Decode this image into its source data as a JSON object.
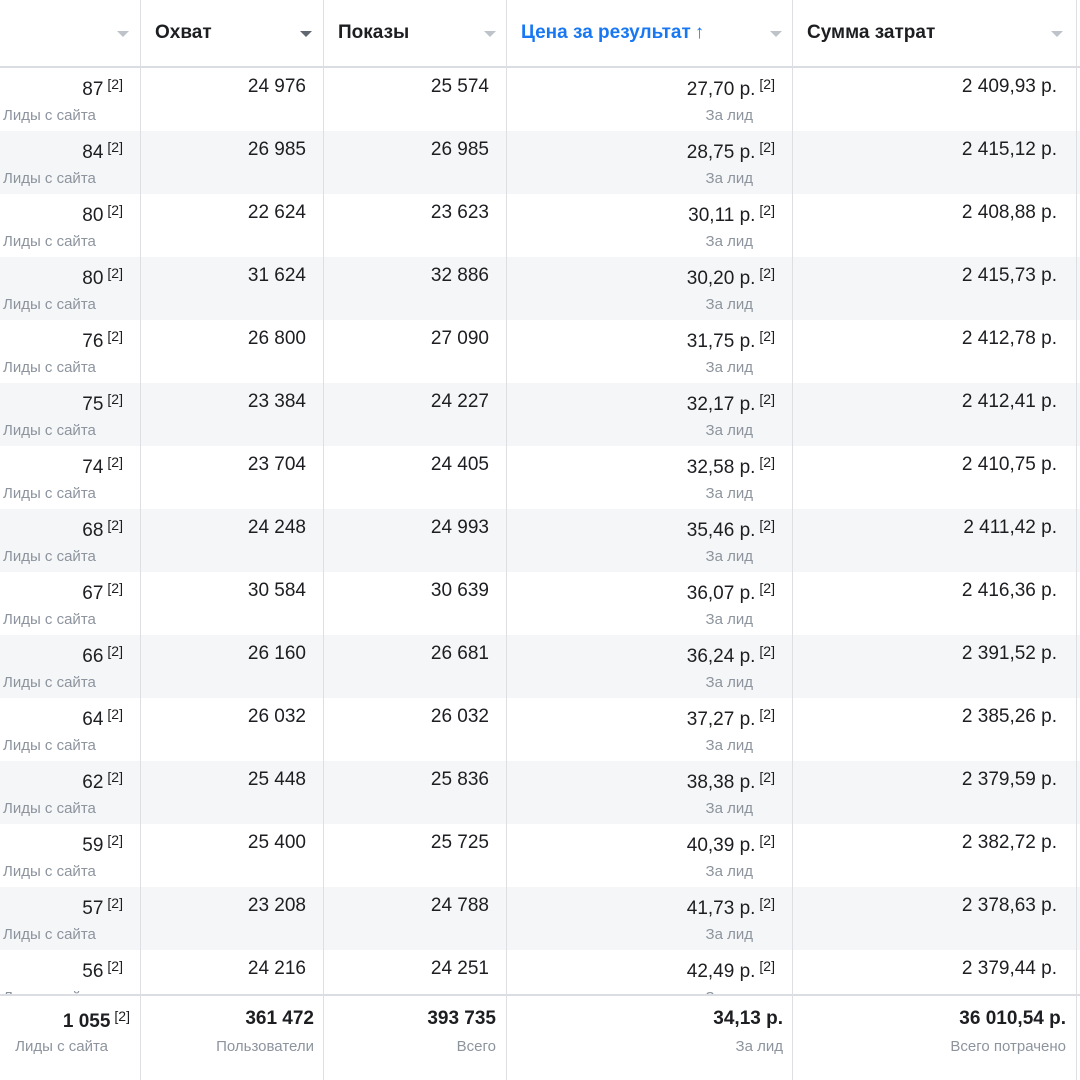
{
  "columns": {
    "results": {
      "label": ""
    },
    "reach": {
      "label": "Охват"
    },
    "impressions": {
      "label": "Показы"
    },
    "cost_per_result": {
      "label": "Цена за результат",
      "sort_indicator": "↑"
    },
    "amount_spent": {
      "label": "Сумма затрат"
    }
  },
  "superscript": "[2]",
  "row_labels": {
    "results": "Лиды с сайта",
    "cost_per_result": "За лид"
  },
  "rows": [
    {
      "results": "87",
      "reach": "24 976",
      "impressions": "25 574",
      "cost_per_result": "27,70 р.",
      "amount_spent": "2 409,93 р."
    },
    {
      "results": "84",
      "reach": "26 985",
      "impressions": "26 985",
      "cost_per_result": "28,75 р.",
      "amount_spent": "2 415,12 р."
    },
    {
      "results": "80",
      "reach": "22 624",
      "impressions": "23 623",
      "cost_per_result": "30,11 р.",
      "amount_spent": "2 408,88 р."
    },
    {
      "results": "80",
      "reach": "31 624",
      "impressions": "32 886",
      "cost_per_result": "30,20 р.",
      "amount_spent": "2 415,73 р."
    },
    {
      "results": "76",
      "reach": "26 800",
      "impressions": "27 090",
      "cost_per_result": "31,75 р.",
      "amount_spent": "2 412,78 р."
    },
    {
      "results": "75",
      "reach": "23 384",
      "impressions": "24 227",
      "cost_per_result": "32,17 р.",
      "amount_spent": "2 412,41 р."
    },
    {
      "results": "74",
      "reach": "23 704",
      "impressions": "24 405",
      "cost_per_result": "32,58 р.",
      "amount_spent": "2 410,75 р."
    },
    {
      "results": "68",
      "reach": "24 248",
      "impressions": "24 993",
      "cost_per_result": "35,46 р.",
      "amount_spent": "2 411,42 р."
    },
    {
      "results": "67",
      "reach": "30 584",
      "impressions": "30 639",
      "cost_per_result": "36,07 р.",
      "amount_spent": "2 416,36 р."
    },
    {
      "results": "66",
      "reach": "26 160",
      "impressions": "26 681",
      "cost_per_result": "36,24 р.",
      "amount_spent": "2 391,52 р."
    },
    {
      "results": "64",
      "reach": "26 032",
      "impressions": "26 032",
      "cost_per_result": "37,27 р.",
      "amount_spent": "2 385,26 р."
    },
    {
      "results": "62",
      "reach": "25 448",
      "impressions": "25 836",
      "cost_per_result": "38,38 р.",
      "amount_spent": "2 379,59 р."
    },
    {
      "results": "59",
      "reach": "25 400",
      "impressions": "25 725",
      "cost_per_result": "40,39 р.",
      "amount_spent": "2 382,72 р."
    },
    {
      "results": "57",
      "reach": "23 208",
      "impressions": "24 788",
      "cost_per_result": "41,73 р.",
      "amount_spent": "2 378,63 р."
    },
    {
      "results": "56",
      "reach": "24 216",
      "impressions": "24 251",
      "cost_per_result": "42,49 р.",
      "amount_spent": "2 379,44 р."
    }
  ],
  "totals": {
    "results": {
      "value": "1 055",
      "label": "Лиды с сайта"
    },
    "reach": {
      "value": "361 472",
      "label": "Пользователи"
    },
    "impressions": {
      "value": "393 735",
      "label": "Всего"
    },
    "cost_per_result": {
      "value": "34,13 р.",
      "label": "За лид"
    },
    "amount_spent": {
      "value": "36 010,54 р.",
      "label": "Всего потрачено"
    }
  },
  "colors": {
    "sorted_header": "#1877f2",
    "alt_row": "#f5f6f7",
    "muted_text": "#8d949e",
    "grid_line": "#dddfe2"
  },
  "icons": {
    "column_menu": "caret-down-icon",
    "sort": "arrow-up-icon"
  }
}
